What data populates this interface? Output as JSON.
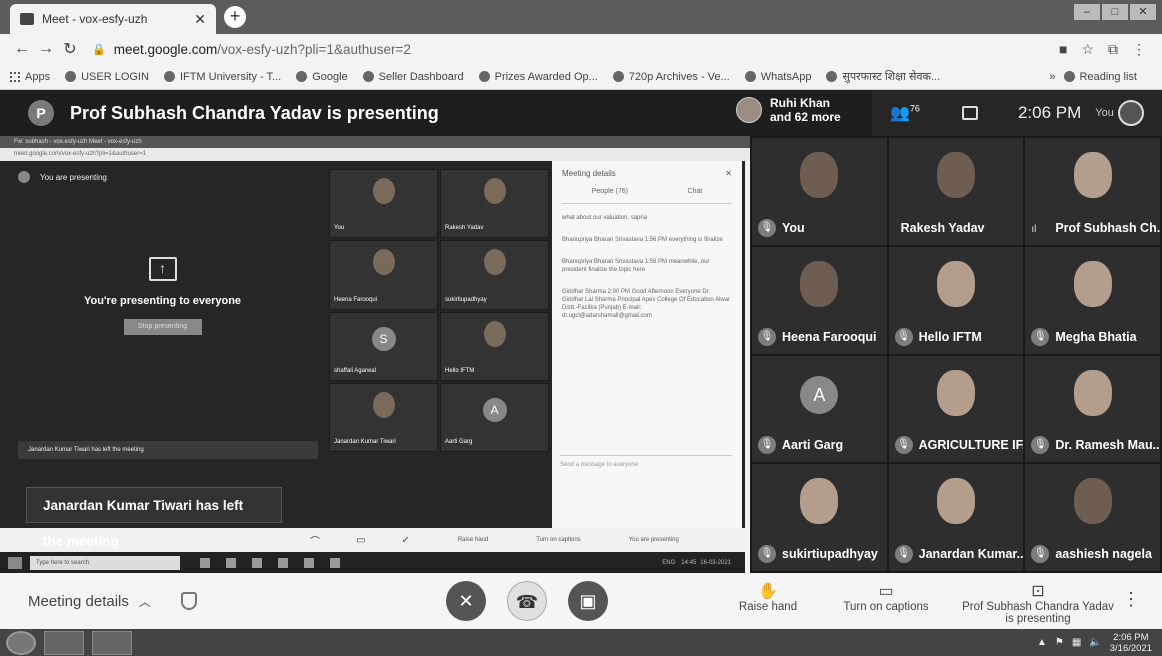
{
  "browser": {
    "tab_title": "Meet - vox-esfy-uzh",
    "address_host": "meet.google.com",
    "address_path": "/vox-esfy-uzh?pli=1&authuser=2",
    "bookmarks": [
      "Apps",
      "USER LOGIN",
      "IFTM University - T...",
      "Google",
      "Seller Dashboard",
      "Prizes Awarded Op...",
      "720p Archives - Ve...",
      "WhatsApp",
      "सुपरफास्ट शिक्षा सेवक..."
    ],
    "reading_list": "Reading list"
  },
  "header": {
    "presenter_initial": "P",
    "presenting_title": "Prof Subhash Chandra Yadav is presenting",
    "others_line1": "Ruhi Khan",
    "others_line2": "and 62 more",
    "people_count": "76",
    "time": "2:06 PM",
    "you_label": "You"
  },
  "shared_screen": {
    "tabs_text": "Fw: subhash - vox-esfy-uzh       Meet - vox-esfy-uzh",
    "addr_text": "meet.google.com/vox-esfy-uzh?pli=1&authuser=1",
    "top_label": "You are presenting",
    "presenting_msg": "You're presenting to everyone",
    "stop_btn": "Stop presenting",
    "left_note": "Janardan Kumar Tiwari has left the meeting",
    "tiles": [
      {
        "label": "You",
        "letter": ""
      },
      {
        "label": "Rakesh Yadav",
        "letter": ""
      },
      {
        "label": "Heena Farooqui",
        "letter": ""
      },
      {
        "label": "sukirtiupadhyay",
        "letter": ""
      },
      {
        "label": "shaffali Agarwal",
        "letter": "S"
      },
      {
        "label": "Hello IFTM",
        "letter": ""
      },
      {
        "label": "Janardan Kumar Tiwari",
        "letter": ""
      },
      {
        "label": "Aarti Garg",
        "letter": "A"
      }
    ],
    "chat_header": "Meeting details",
    "chat_tab_people": "People (76)",
    "chat_tab_chat": "Chat",
    "chat_messages": [
      "what about our valuation, sapna",
      "Bhanupriya Bharan Srivastava  1:56 PM  everything is finalize",
      "Bhanupriya Bharan Srivastava  1:56 PM  meanwhile, our president finalize the topic here",
      "Giridhar Sharma  2:00 PM  Good Afternoon Everyone  Dr. Giridhar Lal Sharma  Principal  Apex College Of Education  Alwar  Distt.-Fazilka (Punjab)  E-mail: dr.ugcl@adarshamall@gmail.com"
    ],
    "chat_input": "Send a message to everyone",
    "bottom_raise": "Raise hand",
    "bottom_captions": "Turn on captions",
    "bottom_presenting": "You are presenting",
    "taskbar_search": "Type here to search",
    "taskbar_time": "14:45",
    "taskbar_date": "16-03-2021",
    "taskbar_lang": "ENG"
  },
  "toast": {
    "text": "Janardan Kumar Tiwari has left the meeting"
  },
  "participants": [
    {
      "name": "You",
      "letter": "",
      "mic": true
    },
    {
      "name": "Rakesh Yadav",
      "letter": "",
      "mic": false
    },
    {
      "name": "Prof Subhash Ch...",
      "letter": "",
      "mic": false
    },
    {
      "name": "Heena Farooqui",
      "letter": "",
      "mic": true
    },
    {
      "name": "Hello IFTM",
      "letter": "",
      "mic": true
    },
    {
      "name": "Megha Bhatia",
      "letter": "",
      "mic": true
    },
    {
      "name": "Aarti Garg",
      "letter": "A",
      "mic": true
    },
    {
      "name": "AGRICULTURE IF...",
      "letter": "",
      "mic": true
    },
    {
      "name": "Dr. Ramesh Mau...",
      "letter": "",
      "mic": true
    },
    {
      "name": "sukirtiupadhyay",
      "letter": "",
      "mic": true
    },
    {
      "name": "Janardan Kumar...",
      "letter": "",
      "mic": true
    },
    {
      "name": "aashiesh nagela",
      "letter": "",
      "mic": true
    }
  ],
  "controls": {
    "meeting_details": "Meeting details",
    "raise_hand": "Raise hand",
    "captions": "Turn on captions",
    "presenting_line1": "Prof Subhash Chandra Yadav",
    "presenting_line2": "is presenting"
  },
  "taskbar": {
    "time": "2:06 PM",
    "date": "3/16/2021"
  }
}
